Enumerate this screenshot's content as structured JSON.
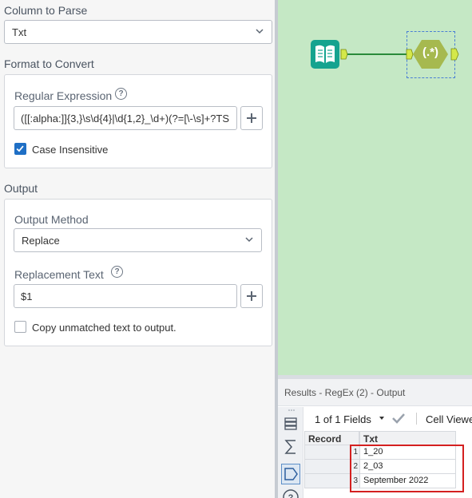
{
  "config": {
    "column_to_parse": {
      "title": "Column to Parse",
      "selected": "Txt"
    },
    "format_to_convert": {
      "title": "Format to Convert",
      "regex_label": "Regular Expression",
      "regex_value": "([[:alpha:]]{3,}\\s\\d{4}|\\d{1,2}_\\d+)(?=[\\-\\s]+?TS",
      "case_insensitive_label": "Case Insensitive",
      "case_insensitive_checked": true
    },
    "output": {
      "title": "Output",
      "method_label": "Output Method",
      "method_selected": "Replace",
      "replacement_label": "Replacement Text",
      "replacement_value": "$1",
      "copy_unmatched_label": "Copy unmatched text to output.",
      "copy_unmatched_checked": false
    }
  },
  "canvas": {
    "input_tool_icon": "book-icon",
    "regex_tool_label": "(.*)",
    "background_color": "#c5e8c5"
  },
  "results": {
    "title": "Results - RegEx (2) - Output",
    "fields_dropdown": "1 of 1 Fields",
    "cell_viewer": "Cell Viewe",
    "columns": [
      "Record",
      "Txt"
    ],
    "rows": [
      {
        "num": "1",
        "txt": "1_20"
      },
      {
        "num": "2",
        "txt": "2_03"
      },
      {
        "num": "3",
        "txt": "September 2022"
      }
    ],
    "highlight_color": "#d42020"
  }
}
